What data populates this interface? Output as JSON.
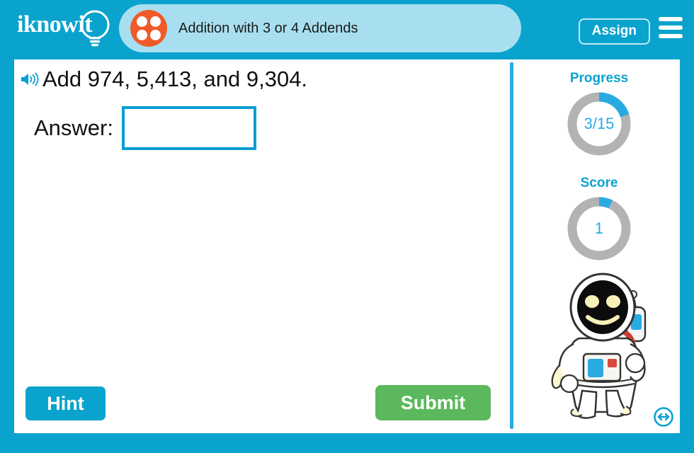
{
  "header": {
    "logo_text": "iknowit",
    "logo_icon": "lightbulb-icon",
    "topic_icon": "four-dots-icon",
    "title": "Addition with 3 or 4 Addends",
    "assign_label": "Assign",
    "menu_icon": "hamburger-menu-icon",
    "bar_color": "#0aa3cd",
    "pill_color": "#a8dff0",
    "dot_color": "#f05a28"
  },
  "question": {
    "speaker_icon": "speaker-audio-icon",
    "text": "Add 974, 5,413, and 9,304.",
    "answer_label": "Answer:",
    "answer_value": "",
    "answer_placeholder": ""
  },
  "actions": {
    "hint_label": "Hint",
    "hint_color": "#0aa3cd",
    "submit_label": "Submit",
    "submit_color": "#5cb85c"
  },
  "sidebar": {
    "progress": {
      "label": "Progress",
      "value_text": "3/15",
      "current": 3,
      "total": 15,
      "percent": 20,
      "arc_color": "#29abe2",
      "track_color": "#b3b3b3"
    },
    "score": {
      "label": "Score",
      "value_text": "1",
      "current": 1,
      "percent": 7,
      "arc_color": "#29abe2",
      "track_color": "#b3b3b3"
    },
    "mascot": "astronaut-mascot",
    "expand_icon": "resize-horizontal-icon"
  }
}
